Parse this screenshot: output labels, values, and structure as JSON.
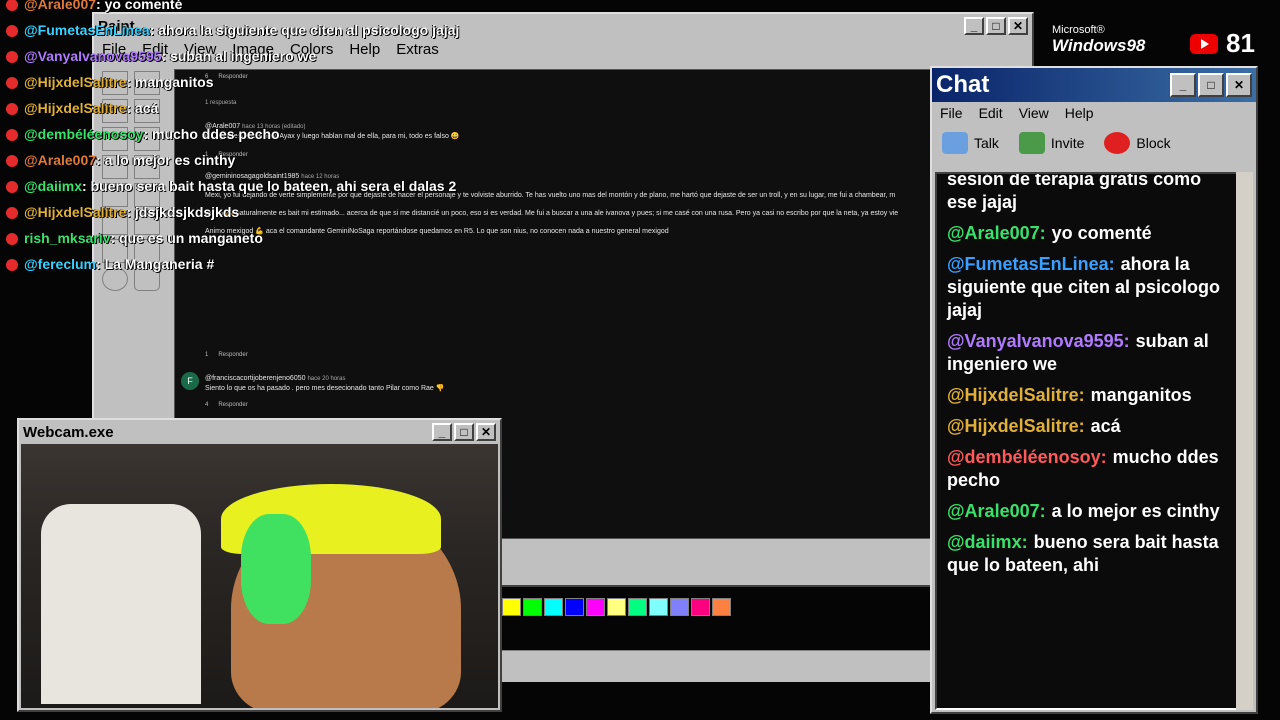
{
  "paint": {
    "title": "Paint",
    "menu": [
      "File",
      "Edit",
      "View",
      "Image",
      "Colors",
      "Help",
      "Extras"
    ],
    "palette": [
      "#ffff00",
      "#00ff00",
      "#00ffff",
      "#0000ff",
      "#ff00ff",
      "#ffff80",
      "#00ff80",
      "#80ffff",
      "#8080ff",
      "#ff0080",
      "#ff8040"
    ],
    "yt": {
      "replies_label": "1 respuesta",
      "reply": "Responder",
      "c1_user": "@Arale007",
      "c1_meta": "hace 13 horas (editado)",
      "c1_text": "na hipocresía, alaban a Ayax y luego hablan mal de ella, para mi, todo es falso 😀",
      "c2_user": "@gemininosagagoldsaint1985",
      "c2_meta": "hace 12 horas",
      "c2_text": "Mexi, yo fui dejando de verte simplemente por que dejaste de hacer el personaje y te volviste aburrido. Te has vuelto uno mas del montón y de plano, me hartó que dejaste de ser un troll, y en su lugar, me fui a chambear, m",
      "c2_more": "Mostrar menos",
      "c3_user": "@franciscacortijoberenjeno6050",
      "c3_meta": "hace 20 horas",
      "c3_text": "Siento lo que os ha pasado . pero mes desecionado tanto Pilar como Rae 👎",
      "likes1": "6",
      "likes2": "1",
      "likes3": "1",
      "likes4": "4",
      "extra1": "Jajaja 😀 naturalmente es bait mi estimado... acerca de que si me distancié un poco, eso si es verdad. Me fui a buscar a una ale ivanova y pues; si me casé con una rusa. Pero ya casi no escribo por que la neta, ya estoy vie",
      "extra2": "Animo mexigod 💪 aca el comandante GeminiNoSaga reportándose quedamos en R5. Lo que son nius, no conocen nada a nuestro general mexigod"
    }
  },
  "overlay": [
    {
      "user": "@Arale007",
      "text": ": yo comenté",
      "color": "#e07a3a"
    },
    {
      "user": "@FumetasEnLinea",
      "text": ": ahora la siguiente que citen al psicologo jajaj",
      "color": "#3ad0ff"
    },
    {
      "user": "@VanyaIvanova9595",
      "text": ": suban al ingeniero we",
      "color": "#b07aff"
    },
    {
      "user": "@HijxdelSalitre",
      "text": ": manganitos",
      "color": "#e0b03a"
    },
    {
      "user": "@HijxdelSalitre",
      "text": ": acá",
      "color": "#e0b03a"
    },
    {
      "user": "@dembéléenosoy",
      "text": ": mucho ddes pecho",
      "color": "#3ae06a"
    },
    {
      "user": "@Arale007",
      "text": ": a lo mejor es cinthy",
      "color": "#e07a3a"
    },
    {
      "user": "@daiimx",
      "text": ": bueno sera bait hasta que lo bateen, ahi sera el dalas 2",
      "color": "#3ae06a"
    },
    {
      "user": "@HijxdelSalitre",
      "text": ": jdsjkdsjkdsjkds",
      "color": "#e0b03a"
    },
    {
      "user": "rish_mksariv",
      "text": ": que es un manganeto",
      "color": "#3ae06a"
    },
    {
      "user": "@fereclum",
      "text": ": La Manganeria #",
      "color": "#3ad0ff"
    }
  ],
  "chat": {
    "title": "Chat",
    "menu": [
      "File",
      "Edit",
      "View",
      "Help"
    ],
    "tools": [
      "Talk",
      "Invite",
      "Block"
    ],
    "messages": [
      {
        "user": "",
        "text": "sesión de terapia gratis como ese jajaj",
        "color": "#ffffff"
      },
      {
        "user": "@Arale007:",
        "text": "yo comenté",
        "color": "#3ae06a"
      },
      {
        "user": "@FumetasEnLinea:",
        "text": "ahora la siguiente que citen al psicologo jajaj",
        "color": "#3aa0ff"
      },
      {
        "user": "@VanyaIvanova9595:",
        "text": "suban al ingeniero we",
        "color": "#b07aff"
      },
      {
        "user": "@HijxdelSalitre:",
        "text": "manganitos",
        "color": "#e0b03a"
      },
      {
        "user": "@HijxdelSalitre:",
        "text": "acá",
        "color": "#e0b03a"
      },
      {
        "user": "@dembéléenosoy:",
        "text": "mucho ddes pecho",
        "color": "#ff5a5a"
      },
      {
        "user": "@Arale007:",
        "text": "a lo mejor es cinthy",
        "color": "#3ae06a"
      },
      {
        "user": "@daiimx:",
        "text": "bueno sera bait hasta que lo bateen, ahi",
        "color": "#3ae06a"
      }
    ]
  },
  "webcam": {
    "title": "Webcam.exe"
  },
  "brand": {
    "os": "Windows98",
    "ms": "Microsoft®",
    "views": "81"
  }
}
